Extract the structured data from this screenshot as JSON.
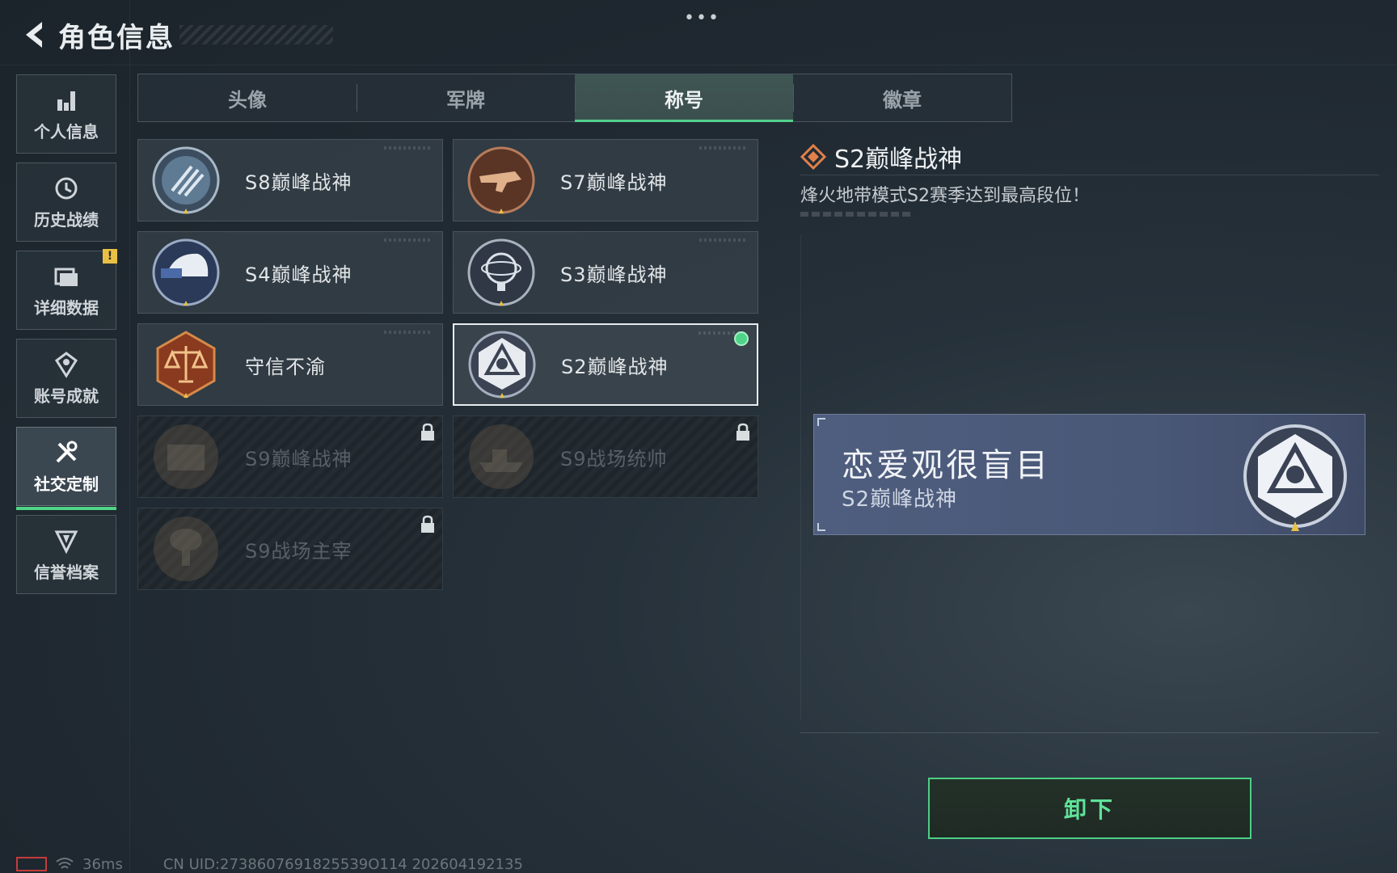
{
  "header": {
    "title": "角色信息",
    "more": "•••"
  },
  "sidebar": {
    "items": [
      {
        "label": "个人信息",
        "icon": "bar-chart-icon"
      },
      {
        "label": "历史战绩",
        "icon": "history-icon"
      },
      {
        "label": "详细数据",
        "icon": "folder-icon",
        "badge": "!"
      },
      {
        "label": "账号成就",
        "icon": "achievement-icon"
      },
      {
        "label": "社交定制",
        "icon": "tools-icon",
        "active": true
      },
      {
        "label": "信誉档案",
        "icon": "credit-shield-icon"
      }
    ]
  },
  "tabs": [
    {
      "label": "头像"
    },
    {
      "label": "军牌"
    },
    {
      "label": "称号",
      "active": true
    },
    {
      "label": "徽章"
    }
  ],
  "titles": [
    {
      "name": "S8巅峰战神",
      "emblem": "s8-emblem",
      "locked": false
    },
    {
      "name": "S7巅峰战神",
      "emblem": "s7-emblem",
      "locked": false
    },
    {
      "name": "S4巅峰战神",
      "emblem": "s4-emblem",
      "locked": false
    },
    {
      "name": "S3巅峰战神",
      "emblem": "s3-emblem",
      "locked": false
    },
    {
      "name": "守信不渝",
      "emblem": "scales-emblem",
      "locked": false
    },
    {
      "name": "S2巅峰战神",
      "emblem": "s2-emblem",
      "locked": false,
      "selected": true,
      "equipped": true
    },
    {
      "name": "S9巅峰战神",
      "emblem": "s9-emblem",
      "locked": true
    },
    {
      "name": "S9战场统帅",
      "emblem": "warship-emblem",
      "locked": true
    },
    {
      "name": "S9战场主宰",
      "emblem": "mushroom-cloud-emblem",
      "locked": true
    }
  ],
  "detail": {
    "title": "S2巅峰战神",
    "description": "烽火地带模式S2赛季达到最高段位！"
  },
  "preview": {
    "player_name": "恋爱观很盲目",
    "title": "S2巅峰战神"
  },
  "actions": {
    "unequip_label": "卸下"
  },
  "status": {
    "ping": "36ms",
    "uid": "CN UID:2738607691825539O114 202604192135"
  },
  "colors": {
    "accent_green": "#4fd488",
    "preview_bg": "#4f5e7e",
    "badge_yellow": "#e8c045",
    "network_red": "#c43b3b"
  }
}
